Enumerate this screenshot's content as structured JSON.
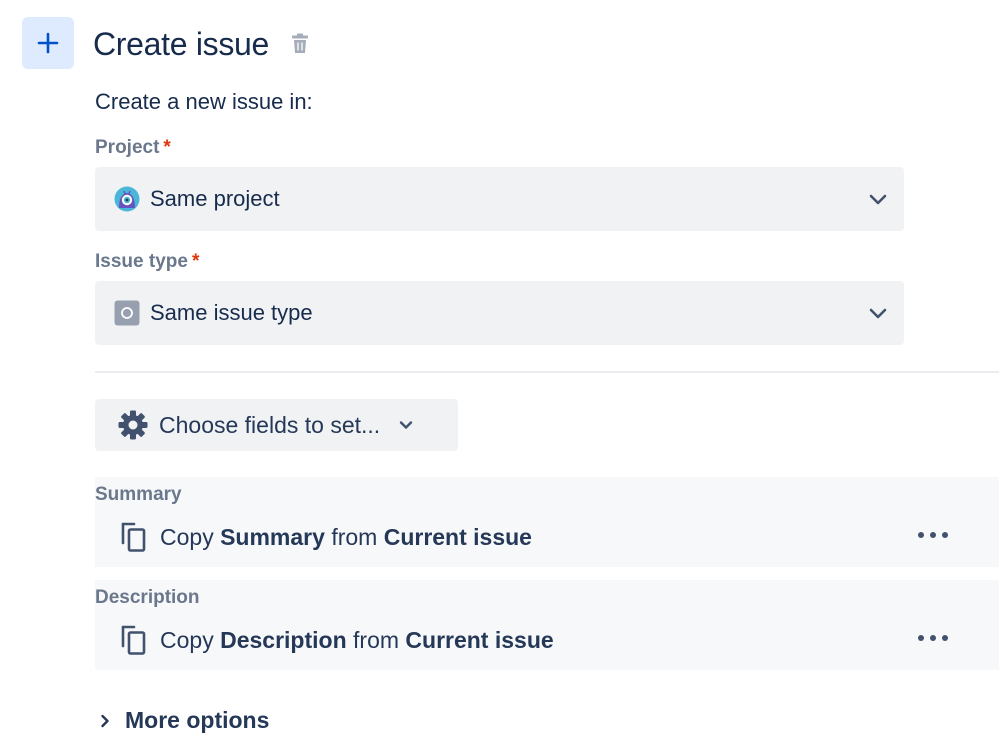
{
  "header": {
    "add_icon": "plus-icon",
    "title": "Create issue",
    "delete_icon": "trash-icon"
  },
  "subtitle": "Create a new issue in:",
  "project": {
    "label": "Project",
    "required_mark": "*",
    "value": "Same project",
    "icon": "project-avatar-icon"
  },
  "issue_type": {
    "label": "Issue type",
    "required_mark": "*",
    "value": "Same issue type",
    "icon": "issue-type-icon"
  },
  "choose_fields": {
    "label": "Choose fields to set...",
    "icon": "gear-icon"
  },
  "fields": [
    {
      "label": "Summary",
      "copy_word": "Copy",
      "field_name": "Summary",
      "from_word": "from",
      "source": "Current issue"
    },
    {
      "label": "Description",
      "copy_word": "Copy",
      "field_name": "Description",
      "from_word": "from",
      "source": "Current issue"
    }
  ],
  "more_options": {
    "label": "More options"
  },
  "colors": {
    "accent": "#0052cc",
    "accent_bg": "#deebff",
    "required": "#de350b",
    "label_gray": "#6b778c",
    "text_dark": "#172b4d"
  }
}
